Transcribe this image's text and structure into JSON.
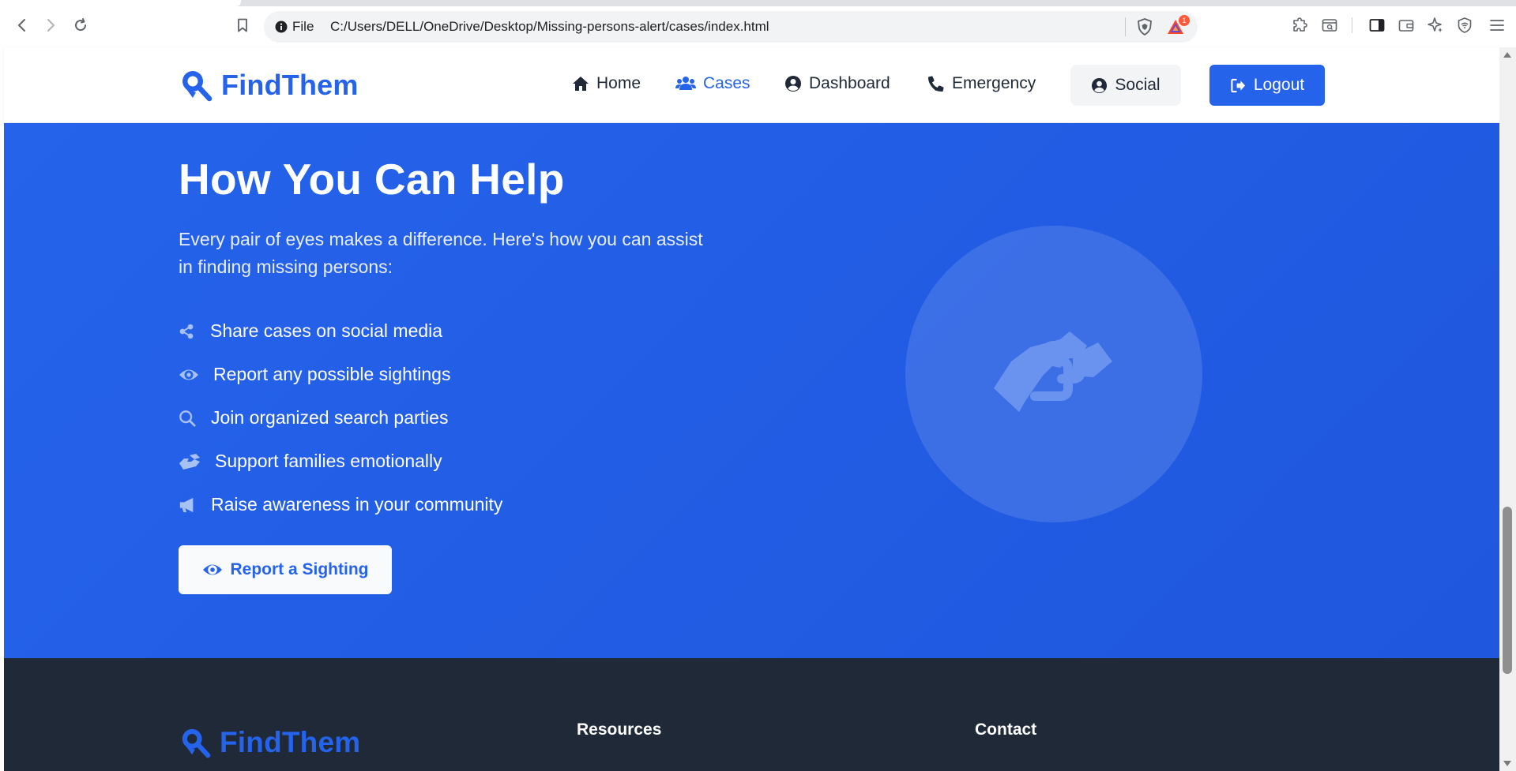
{
  "browser": {
    "file_label": "File",
    "url": "C:/Users/DELL/OneDrive/Desktop/Missing-persons-alert/cases/index.html",
    "rewards_badge": "1",
    "icons": [
      "back-icon",
      "forward-icon",
      "reload-icon",
      "bookmark-icon",
      "info-icon",
      "brave-shield-icon",
      "brave-rewards-icon",
      "extensions-icon",
      "reader-mode-icon",
      "sidebar-icon",
      "wallet-icon",
      "leo-ai-icon",
      "vpn-icon",
      "menu-icon"
    ]
  },
  "header": {
    "brand": "FindThem",
    "nav": [
      {
        "label": "Home",
        "icon": "home-icon"
      },
      {
        "label": "Cases",
        "icon": "users-icon",
        "active": true
      },
      {
        "label": "Dashboard",
        "icon": "user-circle-icon"
      },
      {
        "label": "Emergency",
        "icon": "phone-icon"
      }
    ],
    "social": {
      "label": "Social",
      "icon": "user-circle-icon"
    },
    "logout": {
      "label": "Logout",
      "icon": "sign-out-icon"
    }
  },
  "help": {
    "title": "How You Can Help",
    "intro": "Every pair of eyes makes a difference. Here's how you can assist in finding missing persons:",
    "items": [
      {
        "label": "Share cases on social media",
        "icon": "share-icon"
      },
      {
        "label": "Report any possible sightings",
        "icon": "eye-icon"
      },
      {
        "label": "Join organized search parties",
        "icon": "search-icon"
      },
      {
        "label": "Support families emotionally",
        "icon": "handshake-icon"
      },
      {
        "label": "Raise awareness in your community",
        "icon": "megaphone-icon"
      }
    ],
    "cta": {
      "label": "Report a Sighting",
      "icon": "eye-icon"
    },
    "illustration_icon": "handshake-icon"
  },
  "footer": {
    "brand": "FindThem",
    "headings": [
      "Resources",
      "Contact"
    ]
  },
  "colors": {
    "brand_blue": "#2563eb",
    "footer_bg": "#1f2937",
    "text_dark": "#1f2937"
  }
}
